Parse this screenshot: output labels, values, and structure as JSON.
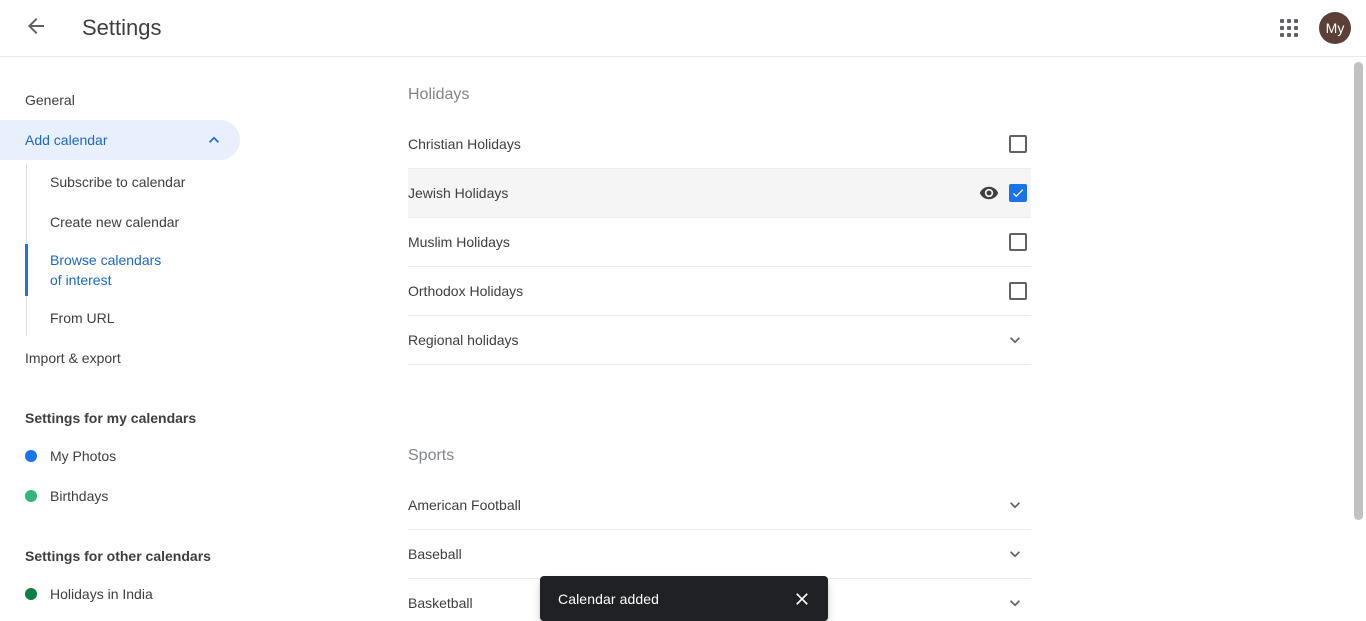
{
  "header": {
    "title": "Settings",
    "back_icon": "arrow-back-icon",
    "apps_icon": "apps-grid-icon",
    "avatar_initials": "My",
    "avatar_color": "#5b4037"
  },
  "sidebar": {
    "items": [
      {
        "label": "General",
        "type": "nav",
        "active": false
      },
      {
        "label": "Add calendar",
        "type": "nav-expandable",
        "active": true,
        "expanded": true,
        "chevron": "chevron-up-icon"
      }
    ],
    "subitems": [
      {
        "label": "Subscribe to calendar",
        "active": false
      },
      {
        "label": "Create new calendar",
        "active": false
      },
      {
        "label": "Browse calendars of interest",
        "active": true
      },
      {
        "label": "From URL",
        "active": false
      }
    ],
    "import_export": {
      "label": "Import & export"
    },
    "my_calendars": {
      "heading": "Settings for my calendars",
      "items": [
        {
          "label": "My Photos",
          "color": "#1a73e8"
        },
        {
          "label": "Birthdays",
          "color": "#33b679"
        }
      ]
    },
    "other_calendars": {
      "heading": "Settings for other calendars",
      "items": [
        {
          "label": "Holidays in India",
          "color": "#0b8043"
        }
      ]
    }
  },
  "main": {
    "groups": [
      {
        "title": "Holidays",
        "rows": [
          {
            "label": "Christian Holidays",
            "control": "checkbox",
            "checked": false,
            "eye": false,
            "hovered": false
          },
          {
            "label": "Jewish Holidays",
            "control": "checkbox",
            "checked": true,
            "eye": true,
            "hovered": true
          },
          {
            "label": "Muslim Holidays",
            "control": "checkbox",
            "checked": false,
            "eye": false,
            "hovered": false
          },
          {
            "label": "Orthodox Holidays",
            "control": "checkbox",
            "checked": false,
            "eye": false,
            "hovered": false
          },
          {
            "label": "Regional holidays",
            "control": "chevron",
            "checked": false,
            "eye": false,
            "hovered": false
          }
        ]
      },
      {
        "title": "Sports",
        "rows": [
          {
            "label": "American Football",
            "control": "chevron",
            "checked": false,
            "eye": false,
            "hovered": false
          },
          {
            "label": "Baseball",
            "control": "chevron",
            "checked": false,
            "eye": false,
            "hovered": false
          },
          {
            "label": "Basketball",
            "control": "chevron",
            "checked": false,
            "eye": false,
            "hovered": false
          }
        ]
      }
    ]
  },
  "toast": {
    "message": "Calendar added",
    "close_icon": "close-icon",
    "background": "#202124"
  },
  "scrollbar": {
    "thumb_color": "#c1c1c1"
  }
}
